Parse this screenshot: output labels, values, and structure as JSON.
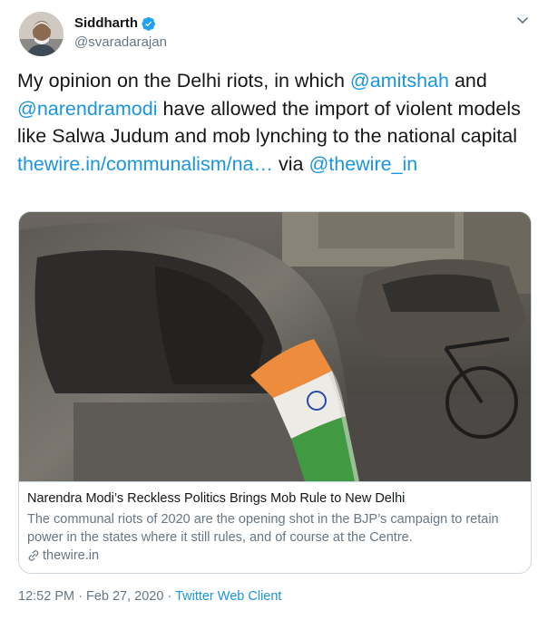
{
  "author": {
    "name": "Siddharth",
    "handle": "@svaradarajan",
    "verified": true
  },
  "tweet": {
    "segments": [
      {
        "text": "My opinion on the Delhi riots, in which ",
        "link": false
      },
      {
        "text": "@amitshah",
        "link": true
      },
      {
        "text": " and ",
        "link": false
      },
      {
        "text": "@narendramodi",
        "link": true
      },
      {
        "text": " have allowed the import of violent models like Salwa Judum and mob lynching to the national capital ",
        "link": false
      },
      {
        "text": "thewire.in/communalism/na…",
        "link": true
      },
      {
        "text": " via ",
        "link": false
      },
      {
        "text": "@thewire_in",
        "link": true
      }
    ]
  },
  "card": {
    "title": "Narendra Modi’s Reckless Politics Brings Mob Rule to New Delhi",
    "description": "The communal riots of 2020 are the opening shot in the BJP’s campaign to retain power in the states where it still rules, and of course at the Centre.",
    "domain": "thewire.in",
    "image_alt_icon": "burned-car-with-flag-photo"
  },
  "meta": {
    "time": "12:52 PM",
    "separator1": " · ",
    "date": "Feb 27, 2020",
    "separator2": " · ",
    "client": "Twitter Web Client"
  },
  "colors": {
    "link": "#1b95e0",
    "secondary_text": "#657786",
    "border": "#ccd6dd",
    "verified": "#1da1f2"
  },
  "icons": [
    "verified-badge-icon",
    "chevron-down-icon",
    "link-icon"
  ]
}
